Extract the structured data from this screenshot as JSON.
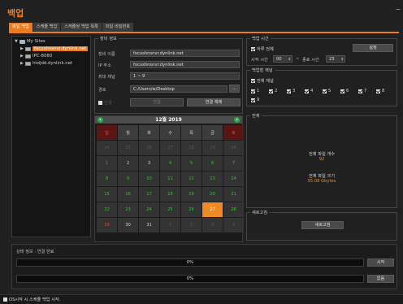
{
  "app": {
    "title": "백업",
    "minimize": "–"
  },
  "tabs": [
    "파일 백업",
    "스케줄 백업",
    "스케줄된 백업 목록",
    "파일 비밀번호"
  ],
  "tree": {
    "root": "My Sites",
    "items": [
      "focushnsnvr.dynlink.net",
      "IPC-8080",
      "htdjdd.dynlink.net"
    ]
  },
  "site_info": {
    "legend": "장비 정보",
    "name_label": "장비 이름",
    "name_value": "focushnsnvr.dynlink.net",
    "ip_label": "IP 주소",
    "ip_value": "focushnsnvr.dynlink.net",
    "channel_label": "최대 채널",
    "channel_value": "1 ~ 9",
    "path_label": "경로",
    "path_value": "C:/Users/w/Desktop",
    "browse_label": "...",
    "check_label": "연결",
    "connect_label": "연결",
    "disconnect_label": "연결 해제"
  },
  "calendar": {
    "title": "12월  2019",
    "weekdays": [
      "일",
      "월",
      "화",
      "수",
      "목",
      "금",
      "토"
    ],
    "today": 27,
    "rows": [
      [
        {
          "d": "24",
          "t": "o"
        },
        {
          "d": "25",
          "t": "o"
        },
        {
          "d": "26",
          "t": "o"
        },
        {
          "d": "27",
          "t": "o"
        },
        {
          "d": "28",
          "t": "o"
        },
        {
          "d": "29",
          "t": "o"
        },
        {
          "d": "30",
          "t": "o"
        }
      ],
      [
        {
          "d": "1",
          "t": "s"
        },
        {
          "d": "2",
          "t": "w"
        },
        {
          "d": "3",
          "t": "w"
        },
        {
          "d": "4",
          "t": "c"
        },
        {
          "d": "5",
          "t": "c"
        },
        {
          "d": "6",
          "t": "c"
        },
        {
          "d": "7",
          "t": "c"
        }
      ],
      [
        {
          "d": "8",
          "t": "c"
        },
        {
          "d": "9",
          "t": "c"
        },
        {
          "d": "10",
          "t": "c"
        },
        {
          "d": "11",
          "t": "c"
        },
        {
          "d": "12",
          "t": "c"
        },
        {
          "d": "13",
          "t": "c"
        },
        {
          "d": "14",
          "t": "c"
        }
      ],
      [
        {
          "d": "15",
          "t": "c"
        },
        {
          "d": "16",
          "t": "c"
        },
        {
          "d": "17",
          "t": "c"
        },
        {
          "d": "18",
          "t": "c"
        },
        {
          "d": "19",
          "t": "c"
        },
        {
          "d": "20",
          "t": "c"
        },
        {
          "d": "21",
          "t": "c"
        }
      ],
      [
        {
          "d": "22",
          "t": "c"
        },
        {
          "d": "23",
          "t": "c"
        },
        {
          "d": "24",
          "t": "c"
        },
        {
          "d": "25",
          "t": "c"
        },
        {
          "d": "26",
          "t": "c"
        },
        {
          "d": "27",
          "t": "today"
        },
        {
          "d": "28",
          "t": "c"
        }
      ],
      [
        {
          "d": "29",
          "t": "s"
        },
        {
          "d": "30",
          "t": "w"
        },
        {
          "d": "31",
          "t": "w"
        },
        {
          "d": "1",
          "t": "o"
        },
        {
          "d": "2",
          "t": "o"
        },
        {
          "d": "3",
          "t": "o"
        },
        {
          "d": "4",
          "t": "o"
        }
      ]
    ]
  },
  "backup_time": {
    "legend": "백업 시간",
    "all_day_label": "하루 전체",
    "set_label": "설정",
    "start_label": "시작 시간",
    "start_value": "00",
    "separator": "~",
    "end_label": "종료 시간",
    "end_value": "23"
  },
  "channels": {
    "legend": "백업할 채널",
    "all_label": "전체 채널",
    "list": [
      "1",
      "2",
      "3",
      "4",
      "5",
      "6",
      "7",
      "8",
      "9"
    ]
  },
  "summary": {
    "legend": "전체",
    "file_count_label": "전체 파일 개수",
    "file_count_value": "92",
    "file_size_label": "전체 파일 크기",
    "file_size_value": "55.08 Gbytes"
  },
  "refresh": {
    "legend": "새로고침",
    "button": "새로고침"
  },
  "status": {
    "label": "상태 정보 :  연결 완료",
    "progress1": 0,
    "progress1_text": "0%",
    "progress2": 0,
    "progress2_text": "0%",
    "start_label": "시작",
    "cancel_label": "없음"
  },
  "footer": {
    "autostart_label": "OS시작 시 스케쥴 백업 시작."
  },
  "colors": {
    "accent": "#ee7a1e",
    "green": "#35c135",
    "red": "#ff3b3b"
  }
}
